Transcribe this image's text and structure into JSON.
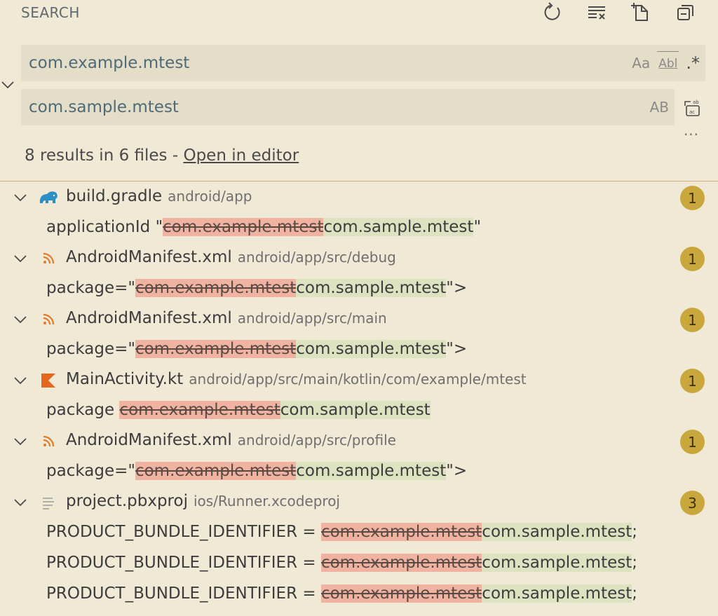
{
  "header": {
    "title": "SEARCH",
    "icons": [
      "refresh-icon",
      "clear-results-icon",
      "new-search-editor-icon",
      "collapse-all-icon"
    ]
  },
  "search": {
    "value": "com.example.mtest",
    "opt_case": "Aa",
    "opt_word": "Abl",
    "opt_regex": ".*"
  },
  "replace": {
    "value": "com.sample.mtest",
    "opt_preserve_case": "AB"
  },
  "summary": {
    "text": "8 results in 6 files - ",
    "link": "Open in editor"
  },
  "colors": {
    "background": "#f0e9d6",
    "input": "#e4ddc8",
    "badge": "#c9a73c",
    "removed": "#f0b3a2",
    "added": "#dde3c1",
    "divider": "#d8a77a"
  },
  "files": [
    {
      "name": "build.gradle",
      "path": "android/app",
      "icon": "gradle-elephant-icon",
      "count": "1",
      "matches": [
        {
          "prefix": "applicationId \"",
          "removed": "com.example.mtest",
          "added": "com.sample.mtest",
          "suffix": "\""
        }
      ]
    },
    {
      "name": "AndroidManifest.xml",
      "path": "android/app/src/debug",
      "icon": "rss-xml-icon",
      "count": "1",
      "matches": [
        {
          "prefix": "package=\"",
          "removed": "com.example.mtest",
          "added": "com.sample.mtest",
          "suffix": "\">"
        }
      ]
    },
    {
      "name": "AndroidManifest.xml",
      "path": "android/app/src/main",
      "icon": "rss-xml-icon",
      "count": "1",
      "matches": [
        {
          "prefix": "package=\"",
          "removed": "com.example.mtest",
          "added": "com.sample.mtest",
          "suffix": "\">"
        }
      ]
    },
    {
      "name": "MainActivity.kt",
      "path": "android/app/src/main/kotlin/com/example/mtest",
      "icon": "kotlin-icon",
      "count": "1",
      "matches": [
        {
          "prefix": "package ",
          "removed": "com.example.mtest",
          "added": "com.sample.mtest",
          "suffix": ""
        }
      ]
    },
    {
      "name": "AndroidManifest.xml",
      "path": "android/app/src/profile",
      "icon": "rss-xml-icon",
      "count": "1",
      "matches": [
        {
          "prefix": "package=\"",
          "removed": "com.example.mtest",
          "added": "com.sample.mtest",
          "suffix": "\">"
        }
      ]
    },
    {
      "name": "project.pbxproj",
      "path": "ios/Runner.xcodeproj",
      "icon": "text-file-icon",
      "count": "3",
      "matches": [
        {
          "prefix": "PRODUCT_BUNDLE_IDENTIFIER = ",
          "removed": "com.example.mtest",
          "added": "com.sample.mtest",
          "suffix": ";"
        },
        {
          "prefix": "PRODUCT_BUNDLE_IDENTIFIER = ",
          "removed": "com.example.mtest",
          "added": "com.sample.mtest",
          "suffix": ";"
        },
        {
          "prefix": "PRODUCT_BUNDLE_IDENTIFIER = ",
          "removed": "com.example.mtest",
          "added": "com.sample.mtest",
          "suffix": ";"
        }
      ]
    }
  ]
}
